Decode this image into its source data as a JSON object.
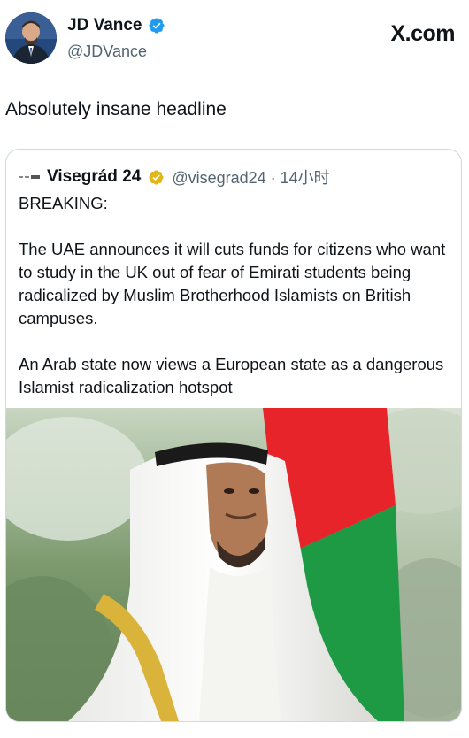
{
  "author": {
    "name": "JD Vance",
    "handle": "@JDVance"
  },
  "source_label": "X.com",
  "tweet_text": "Absolutely insane headline",
  "quote": {
    "name": "Visegrád 24",
    "handle_time": "@visegrad24 · 14小时",
    "para1": "BREAKING:",
    "para2": "The UAE announces it will cuts funds for citizens who want to study in the UK out of fear of Emirati students being radicalized by Muslim Brotherhood Islamists on British campuses.",
    "para3": "An Arab state now views a European state as a dangerous Islamist radicalization hotspot"
  },
  "colors": {
    "verified_blue": "#1d9bf0",
    "verified_gold": "#e2b719",
    "flag_red": "#e8242b",
    "flag_green": "#1e9a45",
    "text_secondary": "#536471"
  },
  "icons": {
    "verified": "verified-badge-icon",
    "gold_verified": "gold-verified-badge-icon"
  }
}
